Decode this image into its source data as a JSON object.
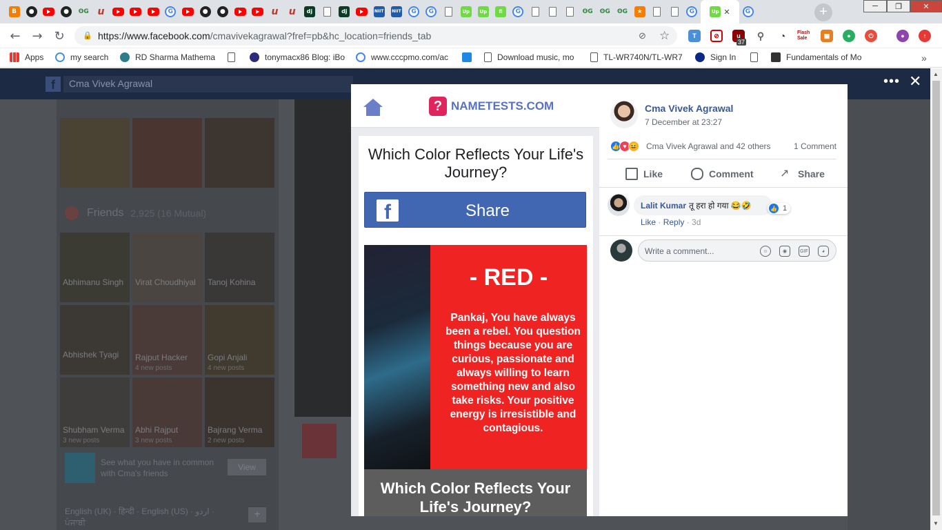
{
  "browser": {
    "url_host": "https://www.facebook.com",
    "url_path": "/cmavivekagrawal?fref=pb&hc_location=friends_tab",
    "tabs": [
      "blogger",
      "github",
      "youtube",
      "github",
      "gmail",
      "u",
      "youtube",
      "youtube",
      "youtube",
      "google",
      "youtube",
      "github",
      "github",
      "youtube",
      "youtube",
      "u",
      "u",
      "dj",
      "doc",
      "dj",
      "youtube",
      "nt",
      "nt",
      "google",
      "google",
      "doc",
      "upwork",
      "upwork",
      "fiverr",
      "g-search",
      "doc",
      "doc",
      "doc",
      "gmail",
      "gmail",
      "gmail",
      "badge",
      "doc",
      "doc",
      "google",
      "upwork-active",
      "google"
    ],
    "new_tab": "+",
    "window_controls": [
      "─",
      "❐",
      "✕"
    ],
    "extension_badge": "37",
    "flash_sale": "Flash Sale"
  },
  "bookmarks": [
    {
      "label": "Apps",
      "icon": "apps-grid-icon"
    },
    {
      "label": "my search",
      "icon": "search-icon"
    },
    {
      "label": "RD Sharma Mathema",
      "icon": "globe-icon"
    },
    {
      "label": "",
      "icon": "page-icon"
    },
    {
      "label": "tonymacx86 Blog: iBo",
      "icon": "blog-icon"
    },
    {
      "label": "www.cccpmo.com/ac",
      "icon": "google-icon"
    },
    {
      "label": "",
      "icon": "home-icon"
    },
    {
      "label": "Download music, mo",
      "icon": "page-icon"
    },
    {
      "label": "TL-WR740N/TL-WR7",
      "icon": "page-icon"
    },
    {
      "label": "Sign In",
      "icon": "jio-icon"
    },
    {
      "label": "",
      "icon": "page-icon"
    },
    {
      "label": "Fundamentals of Mo",
      "icon": "bank-icon"
    }
  ],
  "background": {
    "search_value": "Cma Vivek Agrawal",
    "friends_title": "Friends",
    "friends_count": "2,925 (16 Mutual)",
    "friends": [
      {
        "name": "Abhimanu Singh",
        "sub": ""
      },
      {
        "name": "Virat Choudhiyal",
        "sub": ""
      },
      {
        "name": "Tanoj Kohina",
        "sub": ""
      },
      {
        "name": "Abhishek Tyagi",
        "sub": ""
      },
      {
        "name": "Rajput Hacker",
        "sub": "4 new posts"
      },
      {
        "name": "Gopi Anjali",
        "sub": "4 new posts"
      },
      {
        "name": "Shubham Verma",
        "sub": "3 new posts"
      },
      {
        "name": "Abhi Rajput",
        "sub": "3 new posts"
      },
      {
        "name": "Bajrang Verma",
        "sub": "2 new posts"
      }
    ],
    "common_text": "See what you have in common with Cma's friends",
    "view_label": "View",
    "languages": "English (UK) · हिन्दी · English (US) · اردو · ਪੰਜਾਬੀ",
    "add_label": "+"
  },
  "modal": {
    "brand": "NAMETESTS.COM",
    "quiz_title": "Which Color Reflects Your Life's Journey?",
    "share_label": "Share",
    "result_color": "- RED -",
    "result_text": "Pankaj, You have always been a rebel. You question things because you are curious, passionate and always willing to learn something new and also take risks. Your positive energy is irresistible and contagious.",
    "footer_title": "Which Color Reflects Your Life's Journey?",
    "author": "Cma Vivek Agrawal",
    "post_time": "7 December at 23:27",
    "reactions_text": "Cma Vivek Agrawal and 42 others",
    "comment_count": "1 Comment",
    "actions": [
      "Like",
      "Comment",
      "Share"
    ],
    "comment": {
      "name": "Lalit Kumar",
      "text": "तू हरा हो गया 😂🤣",
      "likes": "1",
      "like_label": "Like",
      "reply_label": "Reply",
      "time": "3d"
    },
    "write_placeholder": "Write a comment..."
  },
  "colors": {
    "chrome_tab_bg": "#dee1e6",
    "fb_blue": "#4267b2",
    "fb_link": "#385898",
    "result_red": "#f02323",
    "nametests_pink": "#e0245e",
    "nametests_blue": "#5871c8"
  }
}
